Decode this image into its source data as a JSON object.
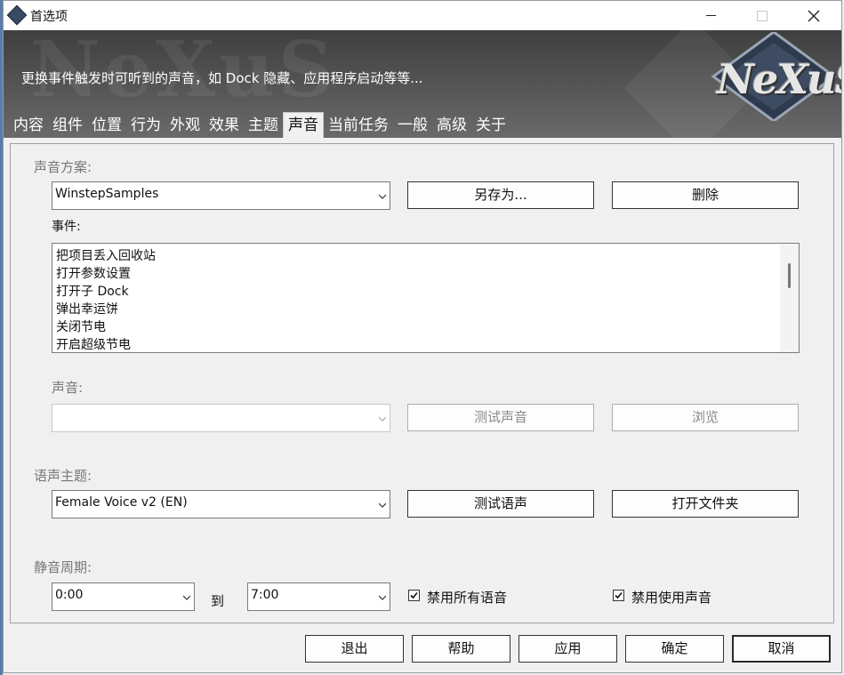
{
  "window": {
    "title": "首选项",
    "banner_description": "更换事件触发时可听到的声音，如 Dock 隐藏、应用程序启动等等...",
    "logo_text": "NeXuS",
    "watermark_text": "NeXuS"
  },
  "tabs": [
    {
      "label": "内容"
    },
    {
      "label": "组件"
    },
    {
      "label": "位置"
    },
    {
      "label": "行为"
    },
    {
      "label": "外观"
    },
    {
      "label": "效果"
    },
    {
      "label": "主题"
    },
    {
      "label": "声音",
      "active": true
    },
    {
      "label": "当前任务"
    },
    {
      "label": "一般"
    },
    {
      "label": "高级"
    },
    {
      "label": "关于"
    }
  ],
  "sound_scheme": {
    "label": "声音方案:",
    "value": "WinstepSamples",
    "save_as_label": "另存为...",
    "delete_label": "删除"
  },
  "events": {
    "label": "事件:",
    "items": [
      "把项目丢入回收站",
      "打开参数设置",
      "打开子 Dock",
      "弹出幸运饼",
      "关闭节电",
      "开启超级节电"
    ]
  },
  "sound": {
    "label": "声音:",
    "value": "",
    "test_label": "测试声音",
    "browse_label": "浏览"
  },
  "voice_theme": {
    "label": "语声主题:",
    "value": "Female Voice v2 (EN)",
    "test_label": "测试语声",
    "open_folder_label": "打开文件夹"
  },
  "quiet_period": {
    "label": "静音周期:",
    "from": "0:00",
    "to_label": "到",
    "to": "7:00",
    "disable_voices_label": "禁用所有语音",
    "disable_voices_checked": true,
    "disable_sounds_label": "禁用使用声音",
    "disable_sounds_checked": true
  },
  "footer": {
    "exit": "退出",
    "help": "帮助",
    "apply": "应用",
    "ok": "确定",
    "cancel": "取消"
  }
}
